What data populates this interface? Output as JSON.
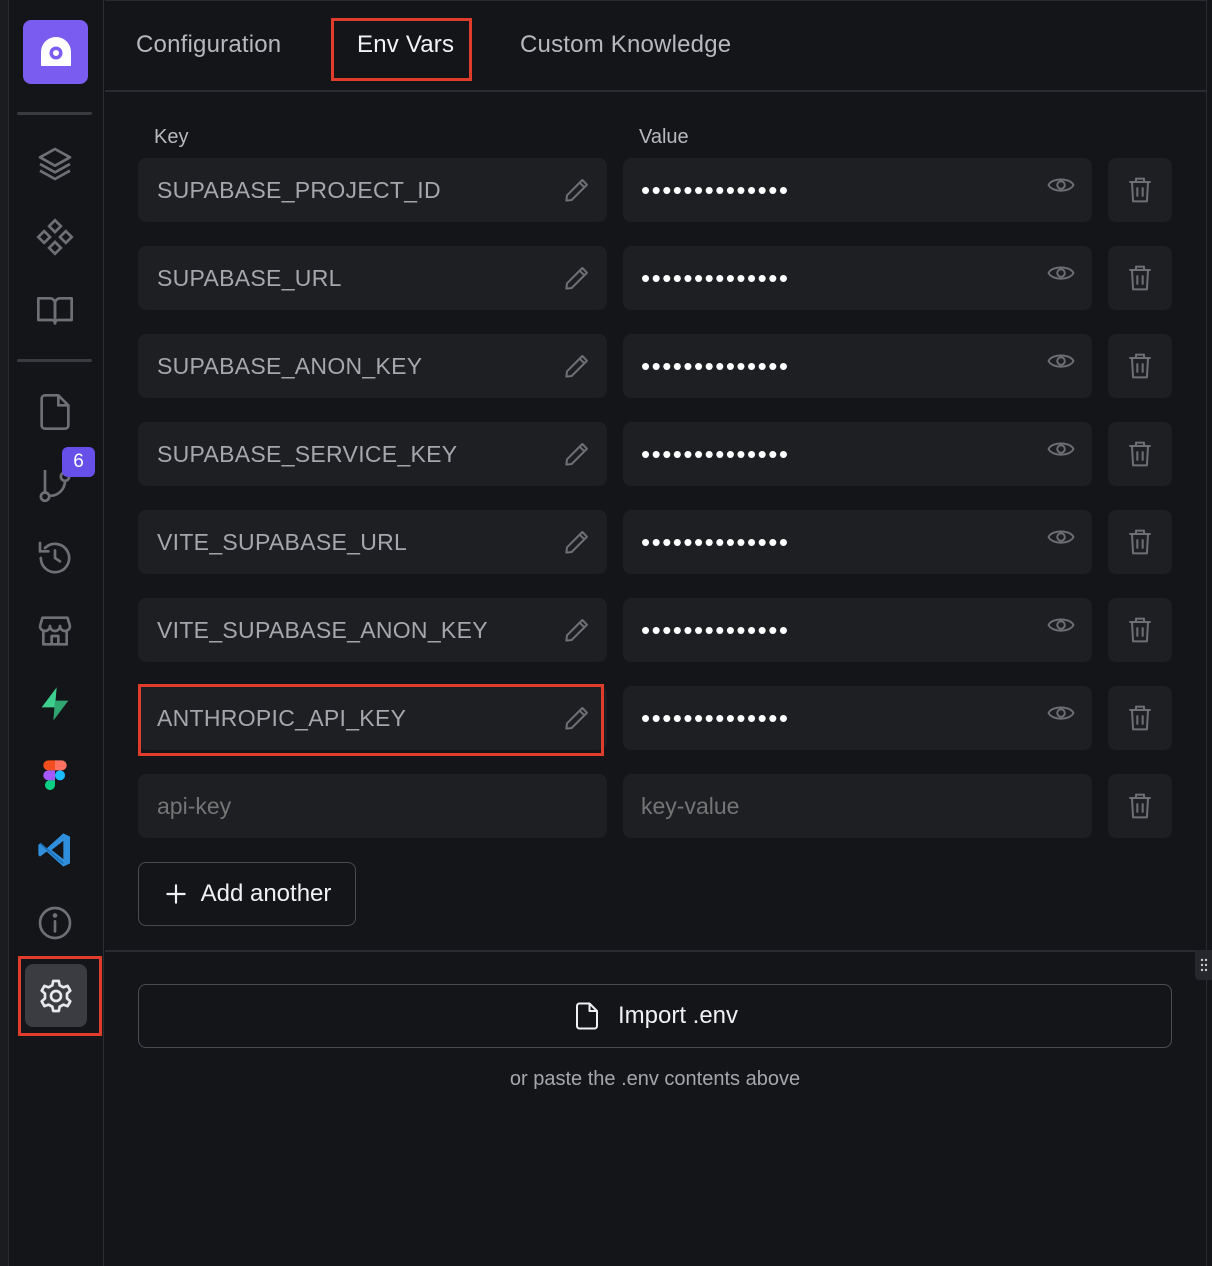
{
  "tabs": [
    {
      "label": "Configuration"
    },
    {
      "label": "Env Vars"
    },
    {
      "label": "Custom Knowledge"
    }
  ],
  "sidebar": {
    "badge_count": "6",
    "accent_color": "#7b5cf0",
    "icons": [
      "layers-icon",
      "components-icon",
      "book-icon",
      "file-icon",
      "git-branch-icon",
      "history-icon",
      "store-icon",
      "supabase-icon",
      "figma-icon",
      "vscode-icon",
      "info-icon",
      "settings-icon"
    ]
  },
  "env": {
    "key_label": "Key",
    "value_label": "Value",
    "rows": [
      {
        "key": "SUPABASE_PROJECT_ID",
        "value": "••••••••••••••"
      },
      {
        "key": "SUPABASE_URL",
        "value": "••••••••••••••"
      },
      {
        "key": "SUPABASE_ANON_KEY",
        "value": "••••••••••••••"
      },
      {
        "key": "SUPABASE_SERVICE_KEY",
        "value": "••••••••••••••"
      },
      {
        "key": "VITE_SUPABASE_URL",
        "value": "••••••••••••••"
      },
      {
        "key": "VITE_SUPABASE_ANON_KEY",
        "value": "••••••••••••••"
      },
      {
        "key": "ANTHROPIC_API_KEY",
        "value": "••••••••••••••"
      }
    ],
    "new_key_placeholder": "api-key",
    "new_value_placeholder": "key-value",
    "add_label": "Add another",
    "import_label": "Import .env",
    "hint": "or paste the .env contents above"
  },
  "highlight_color": "#e03c2c"
}
